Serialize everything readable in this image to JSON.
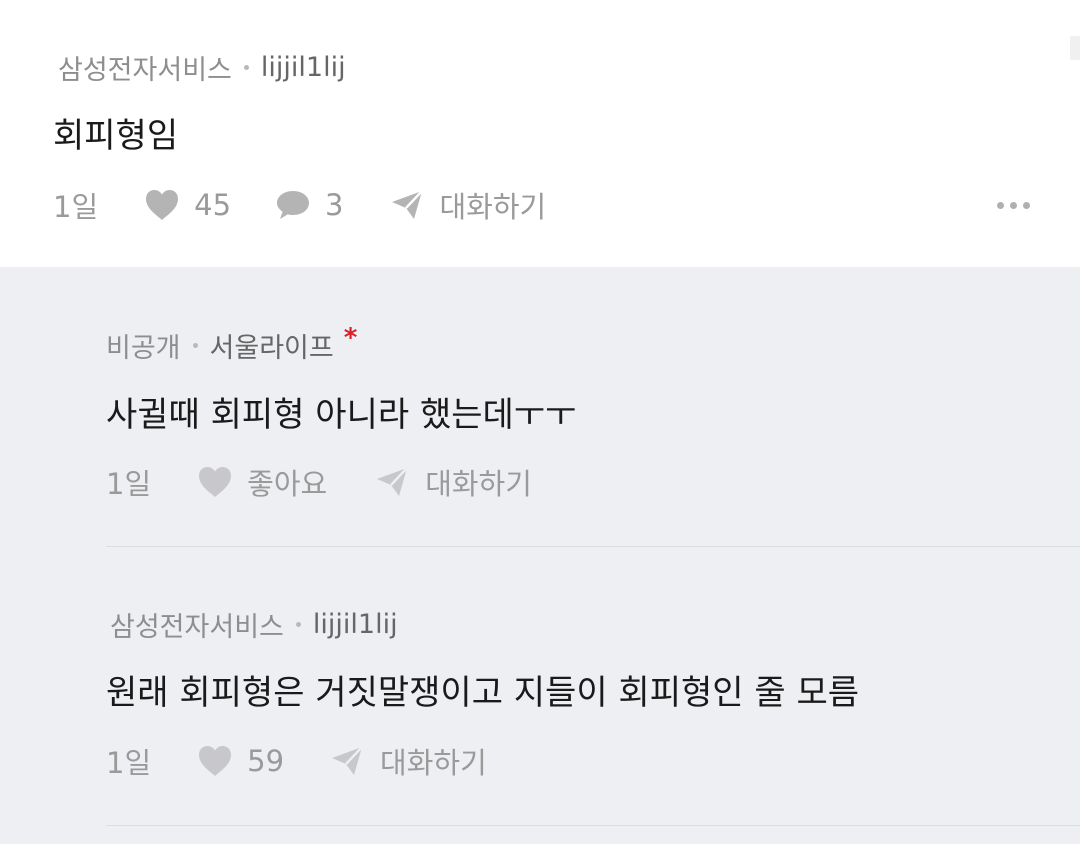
{
  "top_comment": {
    "company": "삼성전자서비스",
    "nickname": "lijjil1lij",
    "text": "회피형임",
    "time": "1일",
    "likes": "45",
    "replies": "3",
    "reply_label": "대화하기",
    "icons": [
      "heart-icon",
      "speech-bubble-icon",
      "send-icon",
      "more-icon"
    ]
  },
  "replies": [
    {
      "company": "비공개",
      "nickname": "서울라이프",
      "badge": "*",
      "text": "사귈때 회피형 아니라 했는데ㅜㅜ",
      "time": "1일",
      "like_label": "좋아요",
      "reply_label": "대화하기"
    },
    {
      "company": "삼성전자서비스",
      "nickname": "lijjil1lij",
      "text": "원래 회피형은 거짓말쟁이고 지들이 회피형인 줄 모름",
      "time": "1일",
      "likes": "59",
      "reply_label": "대화하기"
    }
  ],
  "colors": {
    "reply_background": "#eeeff3",
    "badge": "#d8202a",
    "icon_gray": "#b4b4b4"
  }
}
